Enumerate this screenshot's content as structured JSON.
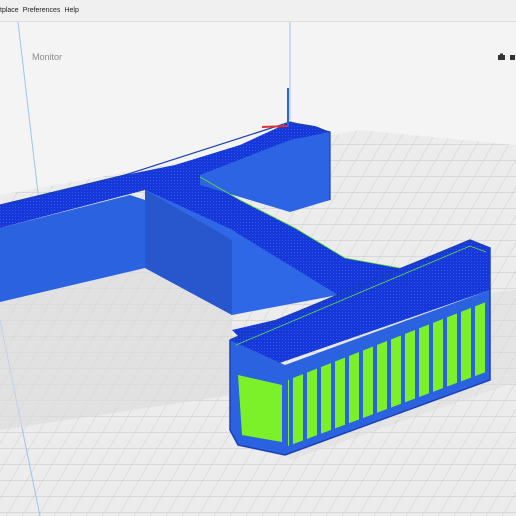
{
  "menubar": {
    "items": [
      "tplace",
      "Preferences",
      "Help"
    ]
  },
  "stage": {
    "tab_label": "Monitor"
  },
  "colors": {
    "build_plate": "#ececec",
    "grid_line": "#c8c8c8",
    "shell_blue": "#2a62e0",
    "top_blue": "#1334d6",
    "infill_green": "#7cf12a",
    "axis_x": "#e53030",
    "axis_y": "#2a62e0"
  },
  "icons": [
    "camera-icon",
    "view-options-icon"
  ]
}
